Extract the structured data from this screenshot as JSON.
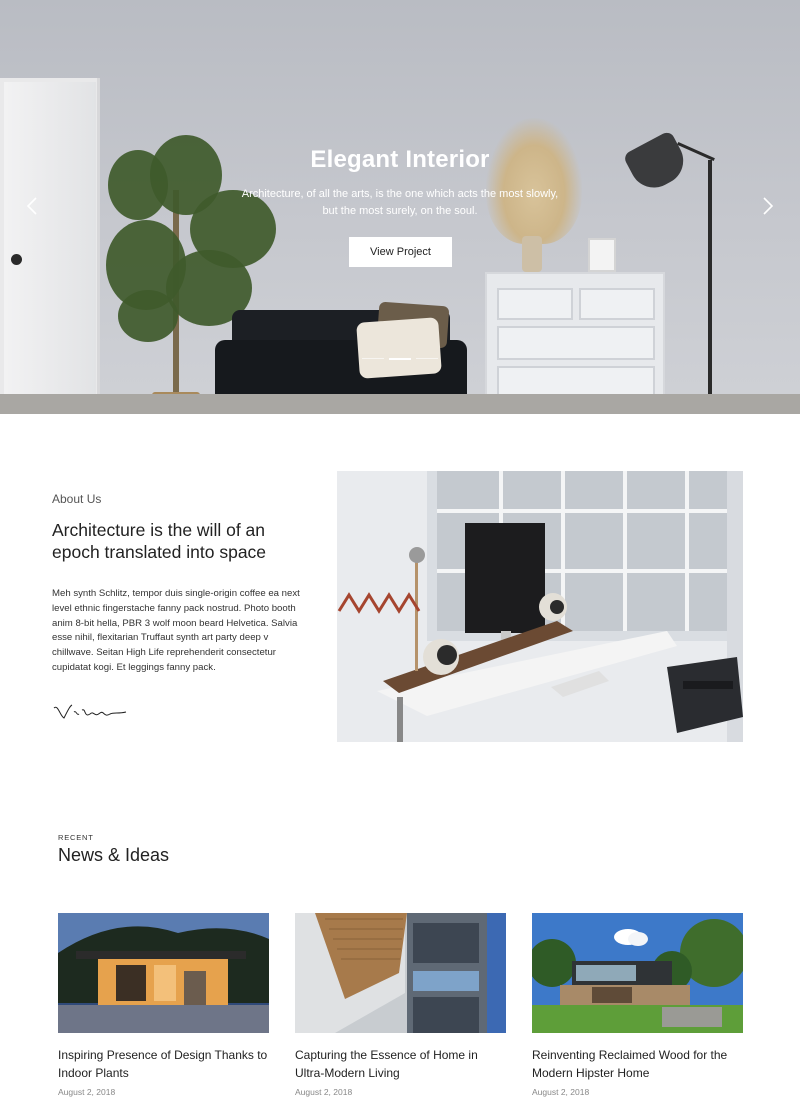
{
  "hero": {
    "title": "Elegant Interior",
    "subtitle_line1": "Architecture, of all the arts, is the one which acts the most slowly,",
    "subtitle_line2": "but the most surely, on the soul.",
    "button_label": "View Project",
    "prev_icon": "chevron-left-icon",
    "next_icon": "chevron-right-icon",
    "slide_indicator": {
      "count": 3,
      "active": 1
    }
  },
  "about": {
    "label": "About Us",
    "heading": "Architecture is the will of an epoch translated into space",
    "body": "Meh synth Schlitz, tempor duis single-origin coffee ea next level ethnic fingerstache fanny pack nostrud. Photo booth anim 8-bit hella, PBR 3 wolf moon beard Helvetica. Salvia esse nihil, flexitarian Truffaut synth art party deep v chillwave. Seitan High Life reprehenderit consectetur cupidatat kogi. Et leggings fanny pack.",
    "signature": "Victor"
  },
  "news": {
    "label": "RECENT",
    "title": "News & Ideas",
    "items": [
      {
        "title": "Inspiring Presence of Design Thanks to Indoor Plants",
        "date": "August 2, 2018"
      },
      {
        "title": "Capturing the Essence of Home in Ultra-Modern Living",
        "date": "August 2, 2018"
      },
      {
        "title": "Reinventing Reclaimed Wood for the Modern Hipster Home",
        "date": "August 2, 2018"
      }
    ]
  }
}
